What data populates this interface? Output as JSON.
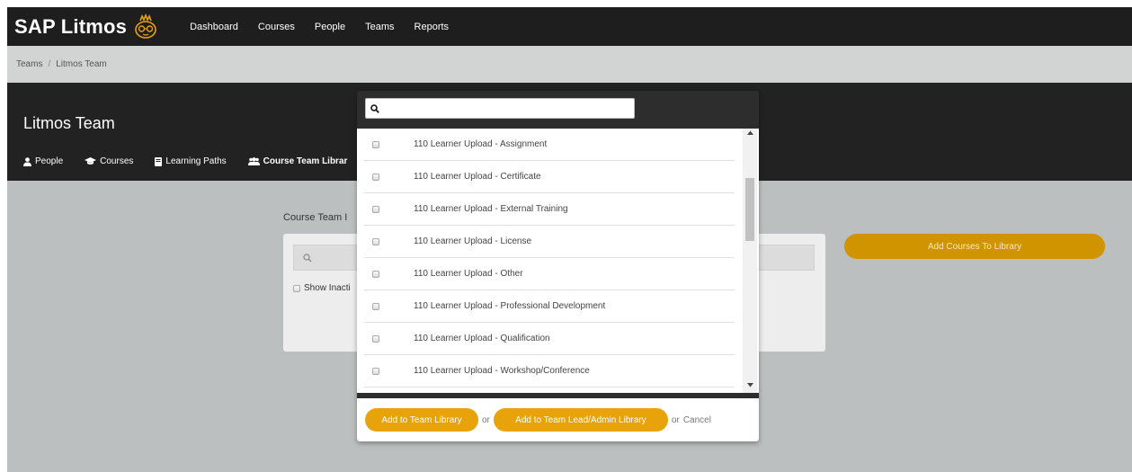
{
  "app": {
    "brand": "SAP Litmos",
    "nav": [
      "Dashboard",
      "Courses",
      "People",
      "Teams",
      "Reports"
    ]
  },
  "breadcrumb": {
    "root": "Teams",
    "separator": "/",
    "current": "Litmos Team"
  },
  "team": {
    "title": "Litmos Team",
    "tabs": [
      {
        "label": "People",
        "icon": "person-icon"
      },
      {
        "label": "Courses",
        "icon": "graduation-cap-icon"
      },
      {
        "label": "Learning Paths",
        "icon": "book-icon"
      },
      {
        "label": "Course Team Librar",
        "icon": "group-icon"
      }
    ]
  },
  "library": {
    "label": "Course Team I",
    "show_inactive_label": "Show Inacti",
    "add_courses_button": "Add Courses To Library"
  },
  "modal": {
    "search_placeholder": "",
    "items": [
      "110 Learner Upload - Assignment",
      "110 Learner Upload - Certificate",
      "110 Learner Upload - External Training",
      "110 Learner Upload - License",
      "110 Learner Upload - Other",
      "110 Learner Upload - Professional Development",
      "110 Learner Upload - Qualification",
      "110 Learner Upload - Workshop/Conference"
    ],
    "add_team_button": "Add to Team Library",
    "or_text": "or",
    "add_lead_button": "Add to Team Lead/Admin Library",
    "or_cancel_text": "or",
    "cancel_link": "Cancel"
  },
  "colors": {
    "nav_bg": "#1e1e1e",
    "accent": "#e8a20a",
    "accent_dark": "#d09400",
    "page_bg": "#bcbfbf"
  }
}
